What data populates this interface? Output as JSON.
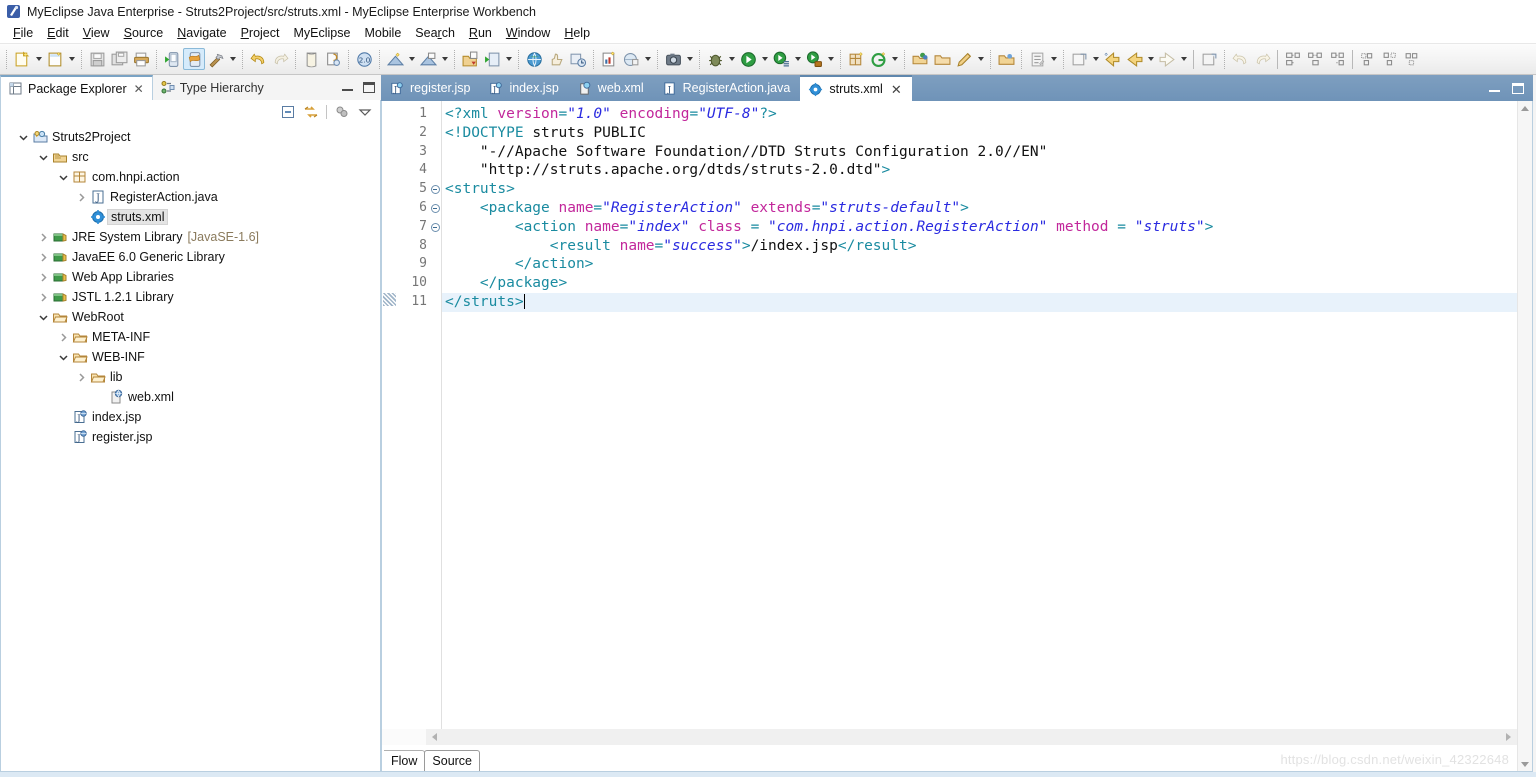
{
  "window": {
    "title": "MyEclipse Java Enterprise - Struts2Project/src/struts.xml - MyEclipse Enterprise Workbench",
    "app_icon": "myeclipse-icon"
  },
  "menubar": {
    "items": [
      {
        "label": "File",
        "mnemonic": "F"
      },
      {
        "label": "Edit",
        "mnemonic": "E"
      },
      {
        "label": "View",
        "mnemonic": "V"
      },
      {
        "label": "Source",
        "mnemonic": "S"
      },
      {
        "label": "Navigate",
        "mnemonic": "N"
      },
      {
        "label": "Project",
        "mnemonic": "P"
      },
      {
        "label": "MyEclipse",
        "mnemonic": ""
      },
      {
        "label": "Mobile",
        "mnemonic": ""
      },
      {
        "label": "Search",
        "mnemonic": "r"
      },
      {
        "label": "Run",
        "mnemonic": "R"
      },
      {
        "label": "Window",
        "mnemonic": "W"
      },
      {
        "label": "Help",
        "mnemonic": "H"
      }
    ]
  },
  "toolbar": {
    "groups": [
      {
        "buttons": [
          {
            "name": "new-wizard",
            "arrow": true
          },
          {
            "name": "new-file",
            "arrow": true
          }
        ]
      },
      {
        "buttons": [
          {
            "name": "save",
            "arrow": false
          },
          {
            "name": "save-all",
            "arrow": false
          },
          {
            "name": "print",
            "arrow": false
          }
        ]
      },
      {
        "buttons": [
          {
            "name": "deploy-run-server",
            "arrow": false
          },
          {
            "name": "myeclipse-deploy",
            "arrow": false,
            "active": true
          },
          {
            "name": "build-hammer",
            "arrow": true
          }
        ]
      },
      {
        "buttons": [
          {
            "name": "undo",
            "arrow": false
          },
          {
            "name": "redo",
            "arrow": false
          }
        ]
      },
      {
        "buttons": [
          {
            "name": "open-type",
            "arrow": false
          },
          {
            "name": "open-resource",
            "arrow": false
          }
        ]
      },
      {
        "buttons": [
          {
            "name": "myeclipse-enterprise",
            "arrow": true
          }
        ]
      },
      {
        "buttons": [
          {
            "name": "database-explorer",
            "arrow": false
          }
        ]
      },
      {
        "buttons": [
          {
            "name": "new-db-connection",
            "arrow": true
          },
          {
            "name": "open-db-browser",
            "arrow": true
          }
        ]
      },
      {
        "buttons": [
          {
            "name": "import-project",
            "arrow": false
          },
          {
            "name": "export-project",
            "arrow": true
          }
        ]
      },
      {
        "buttons": [
          {
            "name": "open-browser",
            "arrow": false
          },
          {
            "name": "validate",
            "arrow": false
          },
          {
            "name": "refresh-rollback",
            "arrow": false
          }
        ]
      },
      {
        "buttons": [
          {
            "name": "new-report",
            "arrow": false
          },
          {
            "name": "web-preview",
            "arrow": true
          }
        ]
      },
      {
        "buttons": [
          {
            "name": "snapshot",
            "arrow": true
          }
        ]
      },
      {
        "buttons": [
          {
            "name": "debug",
            "arrow": true
          },
          {
            "name": "run",
            "arrow": true
          },
          {
            "name": "run-configuration",
            "arrow": true
          },
          {
            "name": "run-external-tools",
            "arrow": true
          }
        ]
      },
      {
        "buttons": [
          {
            "name": "new-package-wizard",
            "arrow": false
          },
          {
            "name": "open-guice",
            "arrow": true
          }
        ]
      },
      {
        "buttons": [
          {
            "name": "open-perspective",
            "arrow": false
          },
          {
            "name": "open-folder",
            "arrow": false
          },
          {
            "name": "edit-pencil",
            "arrow": true
          }
        ]
      },
      {
        "buttons": [
          {
            "name": "open-project-folder",
            "arrow": false
          }
        ]
      },
      {
        "buttons": [
          {
            "name": "insert-template",
            "arrow": true
          },
          {
            "name": "extract-method",
            "arrow": true
          }
        ]
      },
      {
        "buttons": [
          {
            "name": "back-navigate",
            "arrow": false
          },
          {
            "name": "previous-annotation",
            "arrow": true
          },
          {
            "name": "next-annotation",
            "arrow": true
          }
        ]
      },
      {
        "buttons": [
          {
            "name": "show-whitespace",
            "arrow": false
          }
        ]
      },
      {
        "buttons": [
          {
            "name": "undo-edit",
            "arrow": false
          },
          {
            "name": "redo-edit",
            "arrow": false
          }
        ]
      },
      {
        "buttons": [
          {
            "name": "align-left",
            "arrow": false
          },
          {
            "name": "align-center",
            "arrow": false
          },
          {
            "name": "align-right",
            "arrow": false
          }
        ]
      },
      {
        "buttons": [
          {
            "name": "distribute-top",
            "arrow": false
          },
          {
            "name": "distribute-middle",
            "arrow": false
          },
          {
            "name": "distribute-bottom",
            "arrow": false
          }
        ]
      }
    ]
  },
  "left_pane": {
    "tabs": [
      {
        "label": "Package Explorer",
        "icon": "package-explorer-icon",
        "selected": true,
        "closable": true
      },
      {
        "label": "Type Hierarchy",
        "icon": "type-hierarchy-icon",
        "selected": false,
        "closable": false
      }
    ],
    "controls": {
      "minimize": "minimize-icon",
      "maximize": "maximize-icon",
      "collapse_all": "collapse-all-icon",
      "link_with_editor": "link-with-editor-icon",
      "view_menu_filter": "filter-icon",
      "view_menu": "view-menu-icon"
    },
    "tree": [
      {
        "label": "Struts2Project",
        "depth": 0,
        "icon": "java-web-project-icon",
        "twisty": "expanded",
        "selected": false
      },
      {
        "label": "src",
        "depth": 1,
        "icon": "source-folder-icon",
        "twisty": "expanded",
        "selected": false
      },
      {
        "label": "com.hnpi.action",
        "depth": 2,
        "icon": "package-icon",
        "twisty": "expanded",
        "selected": false
      },
      {
        "label": "RegisterAction.java",
        "depth": 3,
        "icon": "java-file-icon",
        "twisty": "collapsed",
        "selected": false
      },
      {
        "label": "struts.xml",
        "depth": 3,
        "icon": "struts-config-icon",
        "twisty": "none",
        "selected": true
      },
      {
        "label": "JRE System Library",
        "sublabel": "[JavaSE-1.6]",
        "depth": 1,
        "icon": "library-icon",
        "twisty": "collapsed",
        "selected": false
      },
      {
        "label": "JavaEE 6.0 Generic Library",
        "depth": 1,
        "icon": "library-icon",
        "twisty": "collapsed",
        "selected": false
      },
      {
        "label": "Web App Libraries",
        "depth": 1,
        "icon": "library-icon",
        "twisty": "collapsed",
        "selected": false
      },
      {
        "label": "JSTL 1.2.1 Library",
        "depth": 1,
        "icon": "library-icon",
        "twisty": "collapsed",
        "selected": false
      },
      {
        "label": "WebRoot",
        "depth": 1,
        "icon": "folder-icon",
        "twisty": "expanded",
        "selected": false
      },
      {
        "label": "META-INF",
        "depth": 2,
        "icon": "folder-icon",
        "twisty": "collapsed",
        "selected": false
      },
      {
        "label": "WEB-INF",
        "depth": 2,
        "icon": "folder-icon",
        "twisty": "expanded",
        "selected": false
      },
      {
        "label": "lib",
        "depth": 3,
        "icon": "folder-icon",
        "twisty": "collapsed",
        "selected": false
      },
      {
        "label": "web.xml",
        "depth": 3,
        "icon": "web-xml-icon",
        "twisty": "none",
        "selected": false
      },
      {
        "label": "index.jsp",
        "depth": 2,
        "icon": "jsp-file-icon",
        "twisty": "none",
        "selected": false
      },
      {
        "label": "register.jsp",
        "depth": 2,
        "icon": "jsp-file-icon",
        "twisty": "none",
        "selected": false
      }
    ]
  },
  "editor": {
    "tabs": [
      {
        "label": "register.jsp",
        "icon": "jsp-file-icon",
        "active": false,
        "closable": false
      },
      {
        "label": "index.jsp",
        "icon": "jsp-file-icon",
        "active": false,
        "closable": false
      },
      {
        "label": "web.xml",
        "icon": "web-xml-icon",
        "active": false,
        "closable": false
      },
      {
        "label": "RegisterAction.java",
        "icon": "java-file-icon",
        "active": false,
        "closable": false
      },
      {
        "label": "struts.xml",
        "icon": "struts-config-icon",
        "active": true,
        "closable": true
      }
    ],
    "controls": {
      "minimize": "minimize-icon",
      "maximize": "maximize-icon"
    },
    "line_numbers": [
      "1",
      "2",
      "3",
      "4",
      "5",
      "6",
      "7",
      "8",
      "9",
      "10",
      "11"
    ],
    "folding_lines": [
      5,
      6,
      7
    ],
    "current_line": 11,
    "caret_line": 11,
    "page_tabs": [
      {
        "label": "Flow",
        "selected": false
      },
      {
        "label": "Source",
        "selected": true
      }
    ],
    "watermark": "https://blog.csdn.net/weixin_42322648",
    "code_lines": [
      {
        "n": 1,
        "tokens": [
          {
            "t": "tg",
            "v": "<?xml "
          },
          {
            "t": "at",
            "v": "version"
          },
          {
            "t": "tg",
            "v": "="
          },
          {
            "t": "vl",
            "v": "\"1.0\""
          },
          {
            "t": "tg",
            "v": " "
          },
          {
            "t": "at",
            "v": "encoding"
          },
          {
            "t": "tg",
            "v": "="
          },
          {
            "t": "vl",
            "v": "\"UTF-8\""
          },
          {
            "t": "tg",
            "v": "?>"
          }
        ]
      },
      {
        "n": 2,
        "tokens": [
          {
            "t": "tg",
            "v": "<!DOCTYPE "
          },
          {
            "t": "tx",
            "v": "struts PUBLIC"
          }
        ]
      },
      {
        "n": 3,
        "tokens": [
          {
            "t": "tx",
            "v": "    \"-//Apache Software Foundation//DTD Struts Configuration 2.0//EN\""
          }
        ]
      },
      {
        "n": 4,
        "tokens": [
          {
            "t": "tx",
            "v": "    \"http://struts.apache.org/dtds/struts-2.0.dtd\""
          },
          {
            "t": "tg",
            "v": ">"
          }
        ]
      },
      {
        "n": 5,
        "tokens": [
          {
            "t": "tg",
            "v": "<struts>"
          }
        ]
      },
      {
        "n": 6,
        "tokens": [
          {
            "t": "tg",
            "v": "    <package "
          },
          {
            "t": "at",
            "v": "name"
          },
          {
            "t": "tg",
            "v": "="
          },
          {
            "t": "vl",
            "v": "\"RegisterAction\""
          },
          {
            "t": "tg",
            "v": " "
          },
          {
            "t": "at",
            "v": "extends"
          },
          {
            "t": "tg",
            "v": "="
          },
          {
            "t": "vl",
            "v": "\"struts-default\""
          },
          {
            "t": "tg",
            "v": ">"
          }
        ]
      },
      {
        "n": 7,
        "tokens": [
          {
            "t": "tg",
            "v": "        <action "
          },
          {
            "t": "at",
            "v": "name"
          },
          {
            "t": "tg",
            "v": "="
          },
          {
            "t": "vl",
            "v": "\"index\""
          },
          {
            "t": "tg",
            "v": " "
          },
          {
            "t": "at",
            "v": "class"
          },
          {
            "t": "tg",
            "v": " = "
          },
          {
            "t": "vl",
            "v": "\"com.hnpi.action.RegisterAction\""
          },
          {
            "t": "tg",
            "v": " "
          },
          {
            "t": "at",
            "v": "method"
          },
          {
            "t": "tg",
            "v": " = "
          },
          {
            "t": "vl",
            "v": "\"struts\""
          },
          {
            "t": "tg",
            "v": ">"
          }
        ]
      },
      {
        "n": 8,
        "tokens": [
          {
            "t": "tg",
            "v": "            <result "
          },
          {
            "t": "at",
            "v": "name"
          },
          {
            "t": "tg",
            "v": "="
          },
          {
            "t": "vl",
            "v": "\"success\""
          },
          {
            "t": "tg",
            "v": ">"
          },
          {
            "t": "tx",
            "v": "/index.jsp"
          },
          {
            "t": "tg",
            "v": "</result>"
          }
        ]
      },
      {
        "n": 9,
        "tokens": [
          {
            "t": "tg",
            "v": "        </action>"
          }
        ]
      },
      {
        "n": 10,
        "tokens": [
          {
            "t": "tg",
            "v": "    </package>"
          }
        ]
      },
      {
        "n": 11,
        "tokens": [
          {
            "t": "tg",
            "v": "</struts>"
          }
        ]
      }
    ]
  },
  "colors": {
    "tag": "#1a8ba0",
    "attribute": "#c2279b",
    "value": "#2a2ae0",
    "text": "#111111",
    "current_line_bg": "#e8f2fb",
    "editor_tab_active_bg": "#ffffff",
    "editor_tabbar_bg": "#7e9fc0",
    "view_tab_border": "#b9cfe0"
  }
}
